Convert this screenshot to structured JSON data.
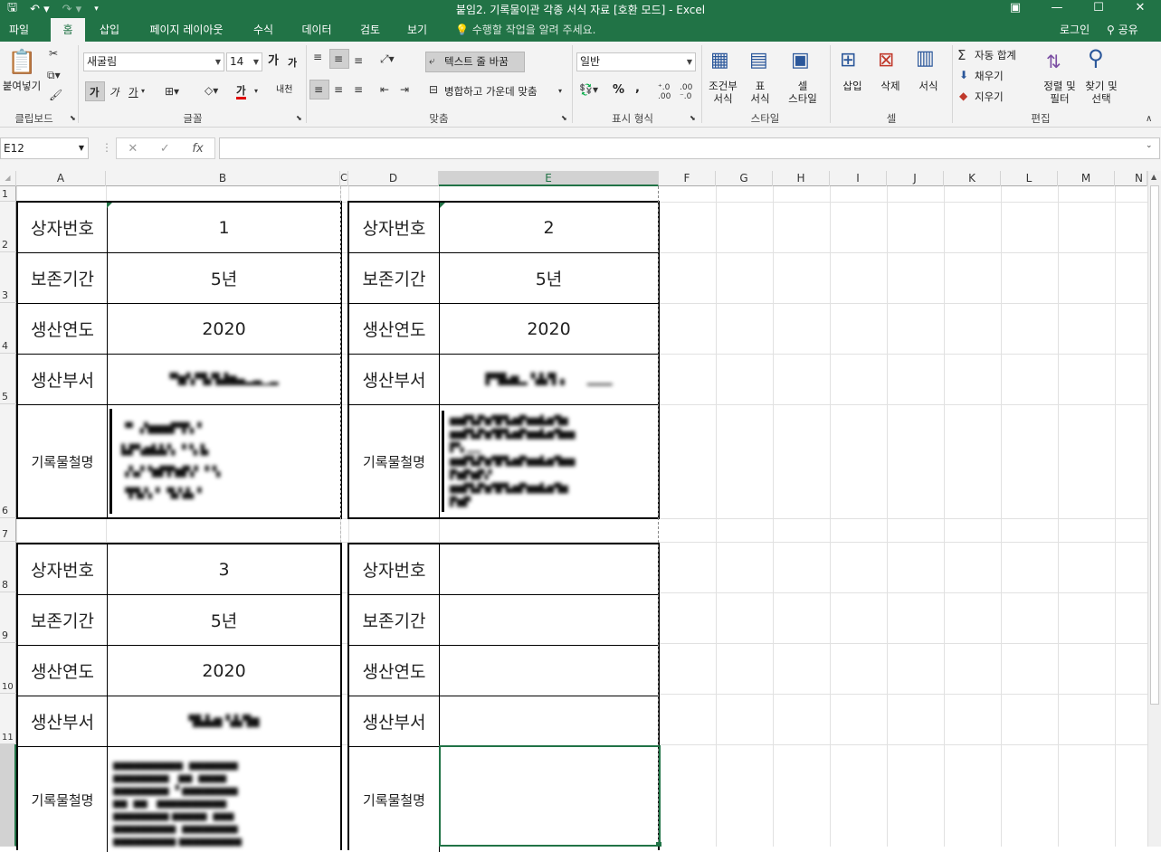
{
  "window": {
    "title": "붙임2. 기록물이관 각종 서식 자료  [호환 모드] - Excel",
    "qat": [
      "save-icon",
      "undo-icon",
      "redo-icon",
      "customize-icon"
    ],
    "buttons": [
      "□",
      "—",
      "□",
      "✕"
    ]
  },
  "tabs": [
    "파일",
    "홈",
    "삽입",
    "페이지 레이아웃",
    "수식",
    "데이터",
    "검토",
    "보기"
  ],
  "tell_me": "수행할 작업을 알려 주세요.",
  "login": "로그인",
  "share": "공유",
  "ribbon": {
    "clipboard": {
      "paste": "붙여넣기",
      "group": "클립보드"
    },
    "font": {
      "name": "새굴림",
      "size": "14",
      "bold": "가",
      "italic": "가",
      "underline": "가",
      "group": "글꼴",
      "grow": "가",
      "shrink": "가",
      "fontcolor": "가",
      "phonetic": "내천"
    },
    "alignment": {
      "wrap": "텍스트 줄 바꿈",
      "merge": "병합하고 가운데 맞춤",
      "group": "맞춤"
    },
    "number": {
      "format": "일반",
      "percent": "%",
      "comma": ",",
      "group": "표시 형식"
    },
    "styles": {
      "conditional": "조건부\n서식",
      "table": "표\n서식",
      "cell": "셀\n스타일",
      "group": "스타일"
    },
    "cells": {
      "insert": "삽입",
      "delete": "삭제",
      "format": "서식",
      "group": "셀"
    },
    "editing": {
      "autosum": "자동 합계",
      "fill": "채우기",
      "clear": "지우기",
      "sort": "정렬 및\n필터",
      "find": "찾기 및\n선택",
      "group": "편집"
    }
  },
  "namebox": "E12",
  "formula": "",
  "columns": [
    "A",
    "B",
    "C",
    "D",
    "E",
    "F",
    "G",
    "H",
    "I",
    "J",
    "K",
    "L",
    "M",
    "N"
  ],
  "rows": [
    "1",
    "2",
    "3",
    "4",
    "5",
    "6",
    "7",
    "8",
    "9",
    "10",
    "11"
  ],
  "labels": {
    "box_no": "상자번호",
    "retention": "보존기간",
    "year": "생산연도",
    "dept": "생산부서",
    "desc": "기록물철명"
  },
  "records": [
    {
      "box_no": "1",
      "retention": "5년",
      "year": "2020"
    },
    {
      "box_no": "2",
      "retention": "5년",
      "year": "2020"
    },
    {
      "box_no": "3",
      "retention": "5년",
      "year": "2020"
    },
    {
      "box_no": "",
      "retention": "",
      "year": ""
    }
  ],
  "colors": {
    "excel_green": "#217346"
  }
}
